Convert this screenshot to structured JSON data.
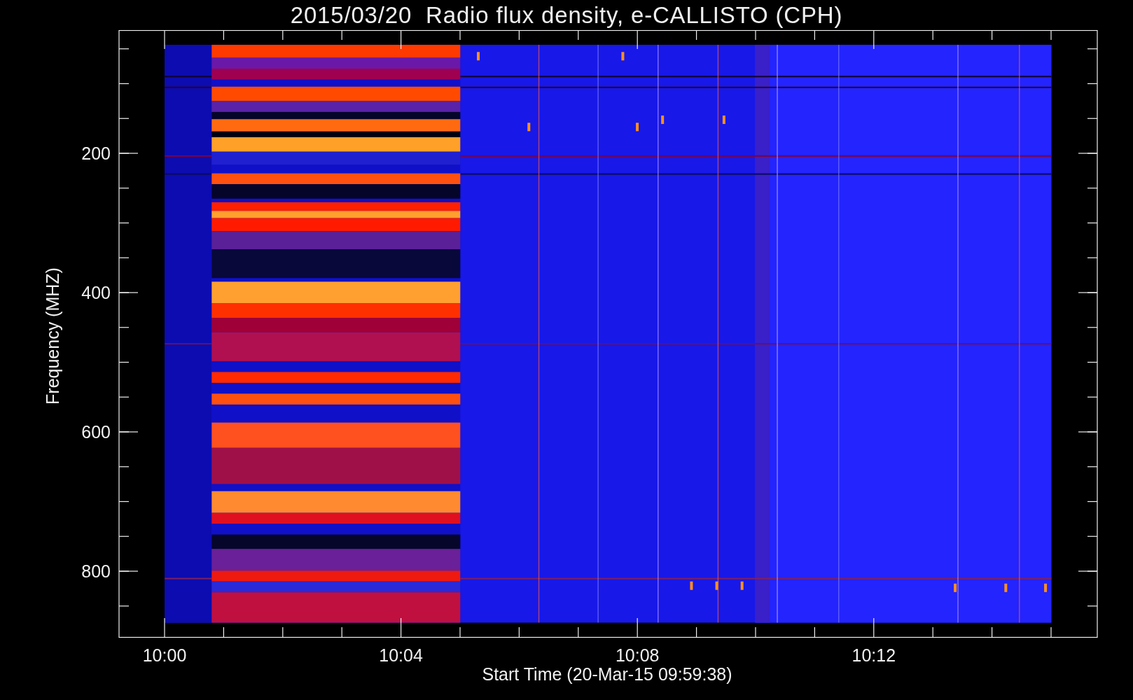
{
  "title": "2015/03/20  Radio flux density, e-CALLISTO (CPH)",
  "y_axis": {
    "label": "Frequency (MHZ)",
    "ticks": [
      "200",
      "400",
      "600",
      "800"
    ]
  },
  "x_axis": {
    "label": "Start Time (20-Mar-15 09:59:38)",
    "ticks": [
      "10:00",
      "10:04",
      "10:08",
      "10:12"
    ]
  }
}
